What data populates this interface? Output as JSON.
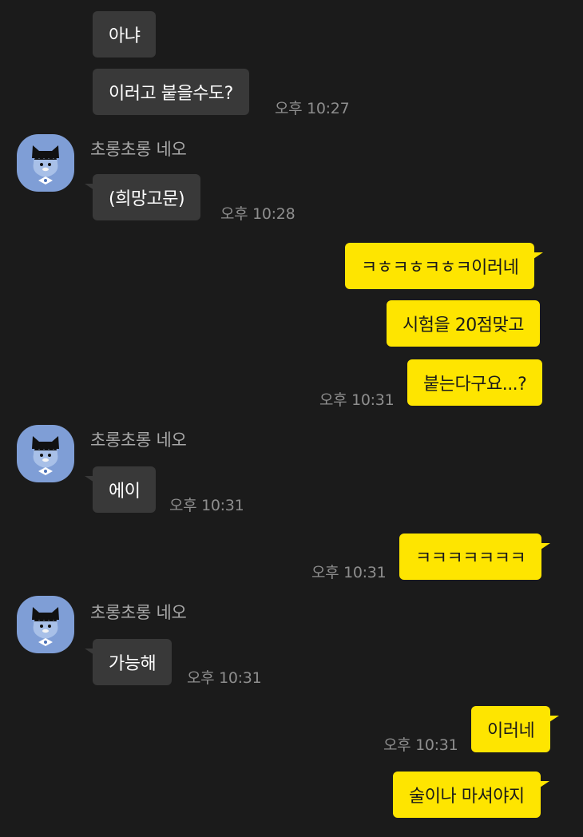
{
  "contact": {
    "name": "초롱초롱 네오"
  },
  "colors": {
    "background": "#1b1b1b",
    "incoming": "#393939",
    "outgoing": "#fee500",
    "avatar_bg": "#7f9ed6"
  },
  "messages": [
    {
      "dir": "in",
      "text": "아냐"
    },
    {
      "dir": "in",
      "text": "이러고 붙을수도?",
      "time": "오후 10:27"
    },
    {
      "dir": "in",
      "sender": "초롱초롱 네오",
      "text": "(희망고문)",
      "time": "오후 10:28"
    },
    {
      "dir": "out",
      "text": "ㅋㅎㅋㅎㅋㅎㅋ이러네"
    },
    {
      "dir": "out",
      "text": "시험을 20점맞고"
    },
    {
      "dir": "out",
      "text": "붙는다구요...?",
      "time": "오후 10:31"
    },
    {
      "dir": "in",
      "sender": "초롱초롱 네오",
      "text": "에이",
      "time": "오후 10:31"
    },
    {
      "dir": "out",
      "text": "ㅋㅋㅋㅋㅋㅋㅋ",
      "time": "오후 10:31"
    },
    {
      "dir": "in",
      "sender": "초롱초롱 네오",
      "text": "가능해",
      "time": "오후 10:31"
    },
    {
      "dir": "out",
      "text": "이러네",
      "time": "오후 10:31"
    },
    {
      "dir": "out",
      "text": "술이나 마셔야지"
    }
  ]
}
